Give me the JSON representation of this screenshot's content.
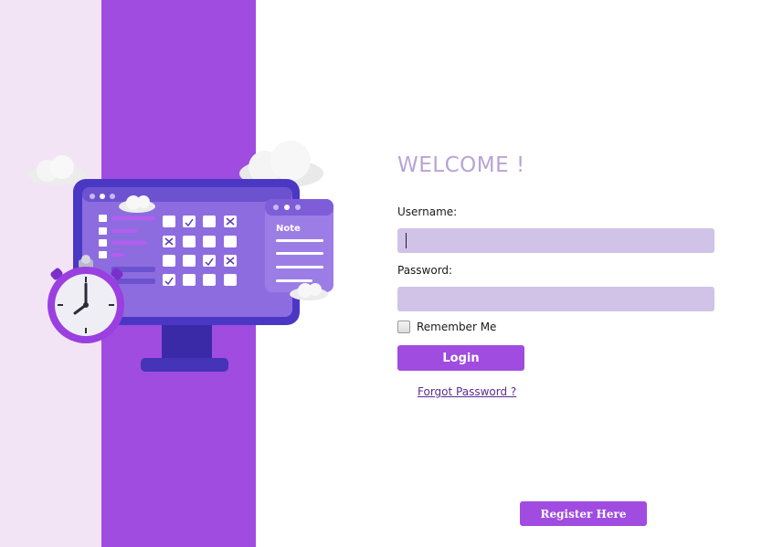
{
  "login": {
    "title": "WELCOME !",
    "username_label": "Username:",
    "username_value": "",
    "password_label": "Password:",
    "password_value": "",
    "remember_label": "Remember Me",
    "remember_checked": false,
    "login_button": "Login",
    "forgot_link": "Forgot Password ?",
    "register_button": "Register Here"
  },
  "illustration": {
    "note_label": "Note",
    "icons": [
      "computer-icon",
      "stopwatch-icon",
      "cloud-icon",
      "note-icon"
    ]
  },
  "colors": {
    "accent": "#a04ce0",
    "panel_light": "#f3e4f5",
    "input_bg": "#d1c2e8",
    "title": "#b9a3d6"
  }
}
